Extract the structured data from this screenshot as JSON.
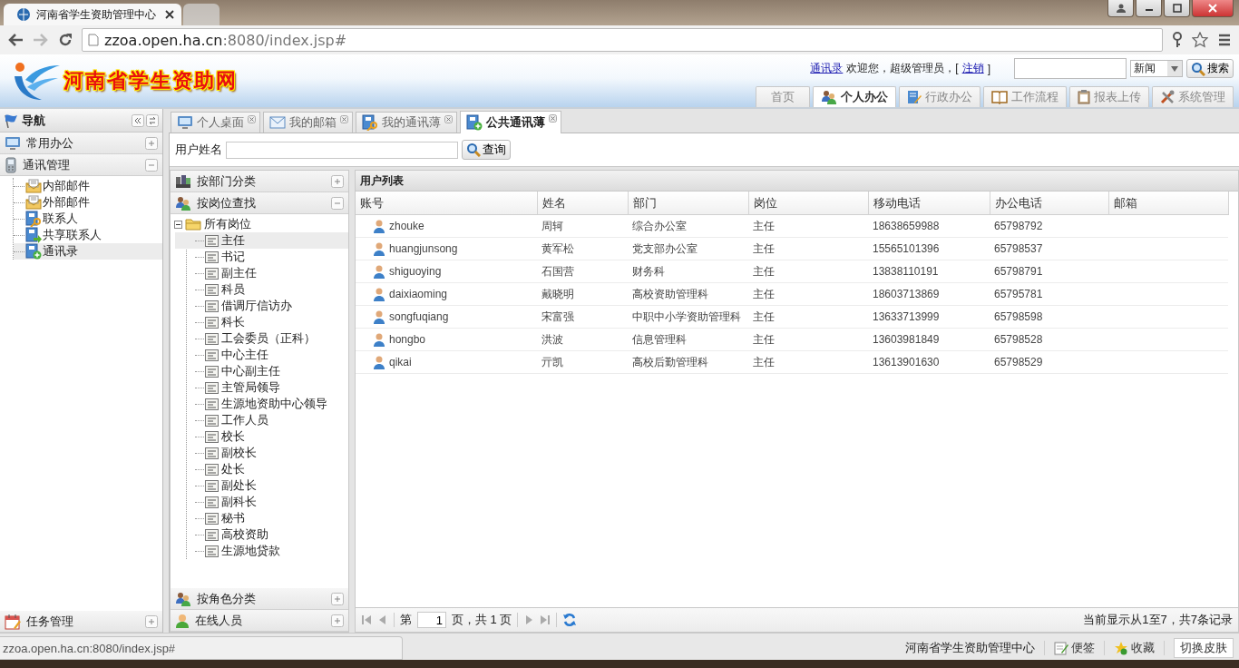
{
  "browser": {
    "tabs": [
      {
        "title": "河南省学生资助管理中心",
        "selected": true
      },
      {
        "selected": false
      }
    ],
    "url_host": "zzoa.open.ha.cn",
    "url_rest": ":8080/index.jsp#"
  },
  "header": {
    "site_title": "河南省学生资助网",
    "contacts_link": "通讯录",
    "welcome": "欢迎您，超级管理员，[",
    "logout_link": "注销",
    "bracket": "]",
    "search_select": "新闻",
    "search_button": "搜索",
    "menu": [
      {
        "label": "首页",
        "selected": false
      },
      {
        "label": "个人办公",
        "selected": true
      },
      {
        "label": "行政办公",
        "selected": false
      },
      {
        "label": "工作流程",
        "selected": false
      },
      {
        "label": "报表上传",
        "selected": false
      },
      {
        "label": "系统管理",
        "selected": false
      }
    ]
  },
  "nav": {
    "title": "导航",
    "sections": [
      {
        "label": "常用办公",
        "expanded": false
      },
      {
        "label": "通讯管理",
        "expanded": true,
        "children": [
          {
            "label": "内部邮件",
            "selected": false
          },
          {
            "label": "外部邮件",
            "selected": false
          },
          {
            "label": "联系人",
            "selected": false
          },
          {
            "label": "共享联系人",
            "selected": false
          },
          {
            "label": "通讯录",
            "selected": true
          }
        ]
      },
      {
        "label": "任务管理",
        "expanded": false
      }
    ]
  },
  "tabs": [
    {
      "label": "个人桌面",
      "selected": false
    },
    {
      "label": "我的邮箱",
      "selected": false
    },
    {
      "label": "我的通讯薄",
      "selected": false
    },
    {
      "label": "公共通讯薄",
      "selected": true
    }
  ],
  "search": {
    "label": "用户姓名",
    "button": "查询"
  },
  "groups": [
    {
      "label": "按部门分类",
      "expanded": false
    },
    {
      "label": "按岗位查找",
      "expanded": true,
      "tree": {
        "label": "所有岗位",
        "expanded": true,
        "children": [
          {
            "label": "主任",
            "selected": true
          },
          {
            "label": "书记",
            "selected": false
          },
          {
            "label": "副主任",
            "selected": false
          },
          {
            "label": "科员",
            "selected": false
          },
          {
            "label": "借调厅信访办",
            "selected": false
          },
          {
            "label": "科长",
            "selected": false
          },
          {
            "label": "工会委员（正科）",
            "selected": false
          },
          {
            "label": "中心主任",
            "selected": false
          },
          {
            "label": "中心副主任",
            "selected": false
          },
          {
            "label": "主管局领导",
            "selected": false
          },
          {
            "label": "生源地资助中心领导",
            "selected": false
          },
          {
            "label": "工作人员",
            "selected": false
          },
          {
            "label": "校长",
            "selected": false
          },
          {
            "label": "副校长",
            "selected": false
          },
          {
            "label": "处长",
            "selected": false
          },
          {
            "label": "副处长",
            "selected": false
          },
          {
            "label": "副科长",
            "selected": false
          },
          {
            "label": "秘书",
            "selected": false
          },
          {
            "label": "高校资助",
            "selected": false
          },
          {
            "label": "生源地贷款",
            "selected": false
          }
        ]
      }
    },
    {
      "label": "按角色分类",
      "expanded": false
    },
    {
      "label": "在线人员",
      "expanded": false
    }
  ],
  "grid": {
    "title": "用户列表",
    "columns": [
      "账号",
      "姓名",
      "部门",
      "岗位",
      "移动电话",
      "办公电话",
      "邮箱"
    ],
    "rows": [
      [
        "zhouke",
        "周轲",
        "综合办公室",
        "主任",
        "18638659988",
        "65798792"
      ],
      [
        "huangjunsong",
        "黄军松",
        "党支部办公室",
        "主任",
        "15565101396",
        "65798537"
      ],
      [
        "shiguoying",
        "石国营",
        "财务科",
        "主任",
        "13838110191",
        "65798791"
      ],
      [
        "daixiaoming",
        "戴晓明",
        "高校资助管理科",
        "主任",
        "18603713869",
        "65795781"
      ],
      [
        "songfuqiang",
        "宋富强",
        "中职中小学资助管理科",
        "主任",
        "13633713999",
        "65798598"
      ],
      [
        "hongbo",
        "洪波",
        "信息管理科",
        "主任",
        "13603981849",
        "65798528"
      ],
      [
        "qikai",
        "亓凯",
        "高校后勤管理科",
        "主任",
        "13613901630",
        "65798529"
      ]
    ],
    "pager": {
      "before": "第",
      "page": "1",
      "after": "页，共 1 页",
      "summary": "当前显示从1至7，共7条记录"
    }
  },
  "status_bar": {
    "url": "zzoa.open.ha.cn:8080/index.jsp#",
    "org": "河南省学生资助管理中心",
    "items": [
      "便签",
      "收藏",
      "切换皮肤"
    ]
  }
}
